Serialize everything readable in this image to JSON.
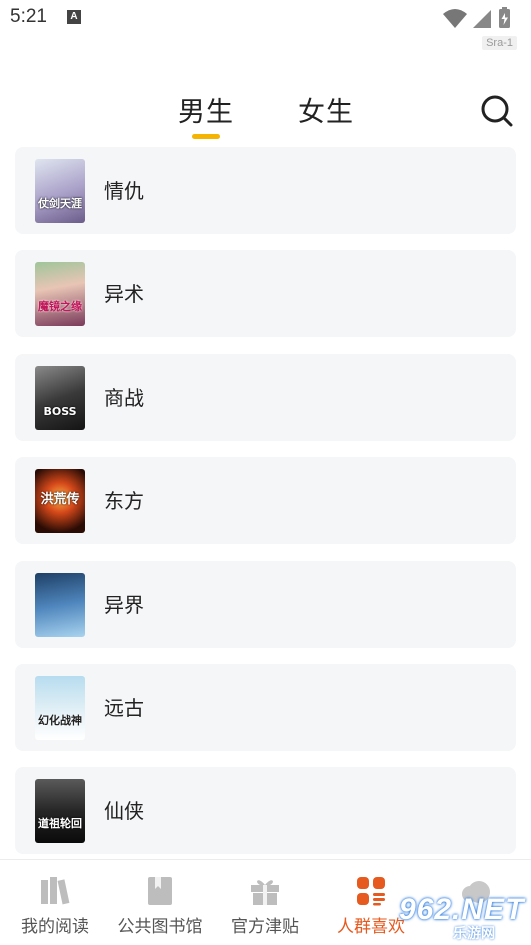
{
  "status_bar": {
    "time": "5:21",
    "notification_icon_letter": "A",
    "sim_tag": "Sra-1",
    "icons": [
      "wifi-icon",
      "signal-icon",
      "battery-charging-icon"
    ]
  },
  "tabs": {
    "male": "男生",
    "female": "女生",
    "active": "male",
    "indicator_color": "#f5b400"
  },
  "categories": [
    {
      "label": "情仇",
      "cover_text": "仗剑天涯",
      "cover_colors": [
        "#cfd6e6",
        "#6b5c8a"
      ]
    },
    {
      "label": "异术",
      "cover_text": "魔镜之缘",
      "cover_colors": [
        "#f1d7c7",
        "#b23a48"
      ]
    },
    {
      "label": "商战",
      "cover_text": "BOSS",
      "cover_colors": [
        "#6a6a6a",
        "#1b1b1b"
      ]
    },
    {
      "label": "东方",
      "cover_text": "洪荒传",
      "cover_colors": [
        "#f08a24",
        "#240c06"
      ]
    },
    {
      "label": "异界",
      "cover_text": "",
      "cover_colors": [
        "#2e5a8c",
        "#8fc0e8"
      ]
    },
    {
      "label": "远古",
      "cover_text": "幻化战神",
      "cover_colors": [
        "#bfe1f2",
        "#f7f7f7"
      ]
    },
    {
      "label": "仙侠",
      "cover_text": "道祖轮回",
      "cover_colors": [
        "#3d3d3d",
        "#0c0c0c"
      ]
    }
  ],
  "bottom_nav": [
    {
      "label": "我的阅读",
      "icon": "bookshelf-icon",
      "active": false
    },
    {
      "label": "公共图书馆",
      "icon": "book-icon",
      "active": false
    },
    {
      "label": "官方津贴",
      "icon": "gift-icon",
      "active": false
    },
    {
      "label": "人群喜欢",
      "icon": "grid-list-icon",
      "active": true
    }
  ],
  "watermark": {
    "text": "962.NET",
    "sub": "乐游网"
  },
  "colors": {
    "accent": "#e65a1f",
    "card_bg": "#f5f6f8"
  }
}
